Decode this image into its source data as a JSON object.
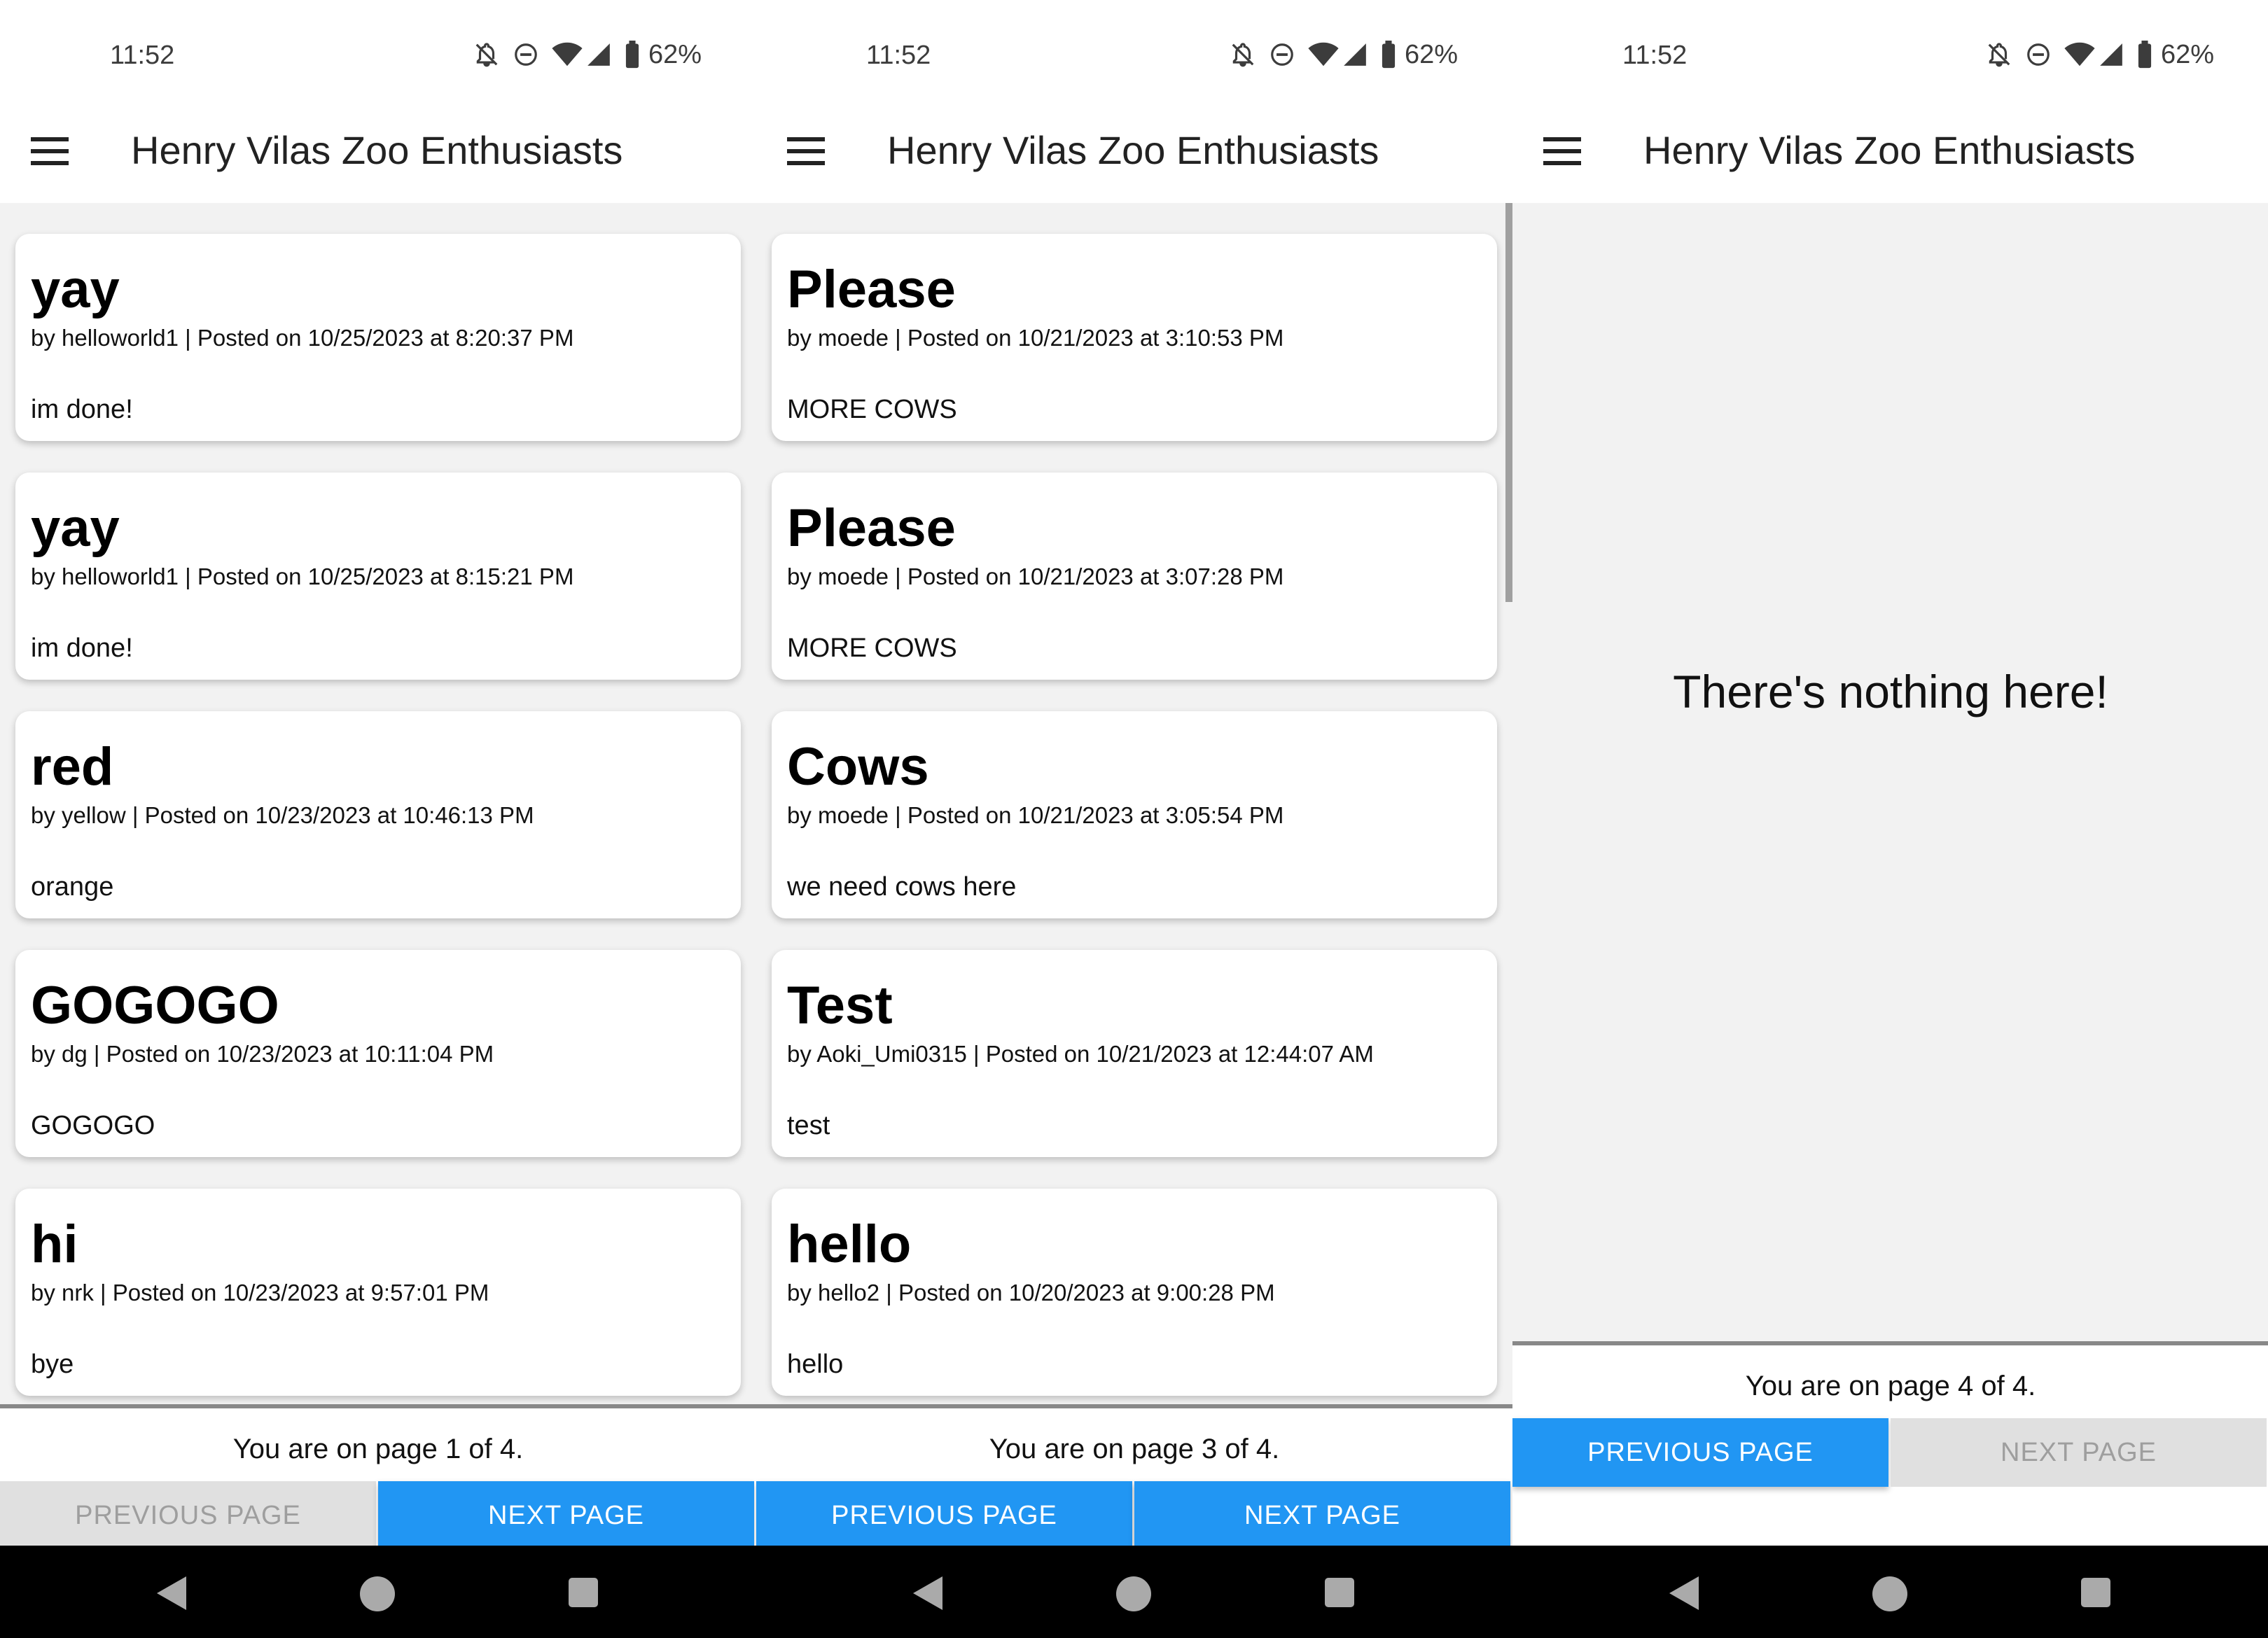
{
  "status_bar": {
    "time": "11:52",
    "battery": "62%"
  },
  "app": {
    "title": "Henry Vilas Zoo Enthusiasts"
  },
  "screens": [
    {
      "posts": [
        {
          "title": "yay",
          "meta": "by helloworld1 | Posted on 10/25/2023 at 8:20:37 PM",
          "body": "im done!"
        },
        {
          "title": "yay",
          "meta": "by helloworld1 | Posted on 10/25/2023 at 8:15:21 PM",
          "body": "im done!"
        },
        {
          "title": "red",
          "meta": "by yellow | Posted on 10/23/2023 at 10:46:13 PM",
          "body": "orange"
        },
        {
          "title": "GOGOGO",
          "meta": "by dg | Posted on 10/23/2023 at 10:11:04 PM",
          "body": "GOGOGO"
        },
        {
          "title": "hi",
          "meta": "by nrk | Posted on 10/23/2023 at 9:57:01 PM",
          "body": "bye"
        }
      ],
      "page_text": "You are on page 1 of 4.",
      "previous_label": "PREVIOUS PAGE",
      "next_label": "NEXT PAGE",
      "previous_enabled": false,
      "next_enabled": true
    },
    {
      "posts": [
        {
          "title": "Please",
          "meta": "by moede | Posted on 10/21/2023 at 3:10:53 PM",
          "body": "MORE COWS"
        },
        {
          "title": "Please",
          "meta": "by moede | Posted on 10/21/2023 at 3:07:28 PM",
          "body": "MORE COWS"
        },
        {
          "title": "Cows",
          "meta": "by moede | Posted on 10/21/2023 at 3:05:54 PM",
          "body": "we need cows here"
        },
        {
          "title": "Test",
          "meta": "by Aoki_Umi0315 | Posted on 10/21/2023 at 12:44:07 AM",
          "body": "test"
        },
        {
          "title": "hello",
          "meta": "by hello2 | Posted on 10/20/2023 at 9:00:28 PM",
          "body": "hello"
        }
      ],
      "page_text": "You are on page 3 of 4.",
      "previous_label": "PREVIOUS PAGE",
      "next_label": "NEXT PAGE",
      "previous_enabled": true,
      "next_enabled": true
    },
    {
      "posts": [],
      "empty_text": "There's nothing here!",
      "page_text": "You are on page 4 of 4.",
      "previous_label": "PREVIOUS PAGE",
      "next_label": "NEXT PAGE",
      "previous_enabled": true,
      "next_enabled": false
    }
  ],
  "colors": {
    "primary": "#2196f3",
    "disabled_bg": "#e0e0e0",
    "disabled_text": "#9e9e9e",
    "background": "#f2f2f2"
  },
  "icons": [
    "notifications-off-icon",
    "do-not-disturb-icon",
    "wifi-icon",
    "cell-signal-icon",
    "battery-icon",
    "menu-icon",
    "back-icon",
    "home-icon",
    "recents-icon"
  ]
}
